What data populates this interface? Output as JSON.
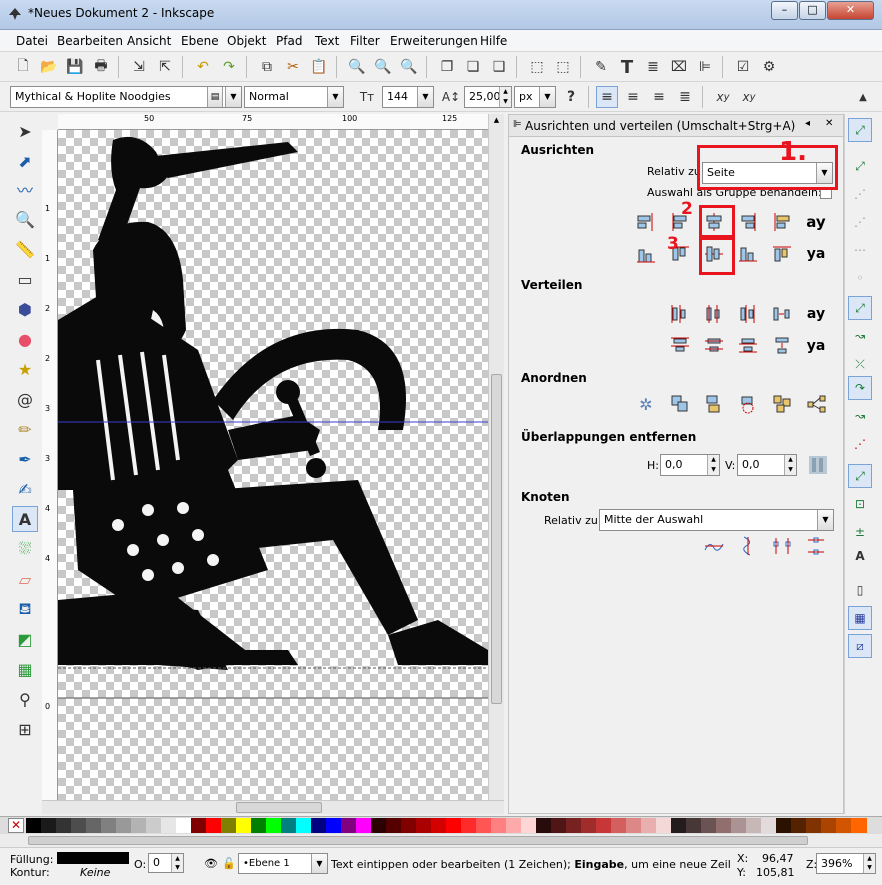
{
  "window": {
    "title": "*Neues Dokument 2 - Inkscape",
    "minimize": "–",
    "maximize": "□",
    "close": "✕"
  },
  "menu": [
    "Datei",
    "Bearbeiten",
    "Ansicht",
    "Ebene",
    "Objekt",
    "Pfad",
    "Text",
    "Filter",
    "Erweiterungen",
    "Hilfe"
  ],
  "text_toolbar": {
    "font_family": "Mythical & Hoplite Noodgies",
    "font_style": "Normal",
    "font_size": "144",
    "line_spacing": "25,00",
    "unit": "px",
    "help": "?"
  },
  "rulers": {
    "top": [
      "50",
      "75",
      "100",
      "125"
    ],
    "left": [
      "1",
      "1",
      "2",
      "2",
      "3",
      "3",
      "4",
      "4",
      "0"
    ]
  },
  "panel": {
    "title": "Ausrichten und verteilen (Umschalt+Strg+A)",
    "align": {
      "heading": "Ausrichten",
      "relative_label": "Relativ zu:",
      "relative_value": "Seite",
      "group_label": "Auswahl als Gruppe behandeln:"
    },
    "distribute": {
      "heading": "Verteilen"
    },
    "arrange": {
      "heading": "Anordnen"
    },
    "overlap": {
      "heading": "Überlappungen entfernen",
      "h_label": "H:",
      "h_value": "0,0",
      "v_label": "V:",
      "v_value": "0,0"
    },
    "nodes": {
      "heading": "Knoten",
      "relative_label": "Relativ zu:",
      "relative_value": "Mitte der Auswahl"
    },
    "annotations": [
      "1.",
      "2",
      "3"
    ]
  },
  "status": {
    "fill_label": "Füllung:",
    "stroke_label": "Kontur:",
    "stroke_value": "Keine",
    "opacity_label": "O:",
    "opacity_value": "0",
    "layer": "•Ebene 1",
    "message_pre": "Text eintippen oder bearbeiten (1 Zeichen); ",
    "message_bold": "Eingabe",
    "message_post": ", um eine neue Zeile zu...",
    "x_label": "X:",
    "x_value": "96,47",
    "y_label": "Y:",
    "y_value": "105,81",
    "zoom_label": "Z:",
    "zoom_value": "396%"
  },
  "colors": {
    "accent": "#e8141e",
    "guide": "#3b3bd4",
    "figure": "#0a0a0a"
  },
  "palette": [
    "#000000",
    "#1a1a1a",
    "#333333",
    "#4d4d4d",
    "#666666",
    "#808080",
    "#999999",
    "#b3b3b3",
    "#cccccc",
    "#e6e6e6",
    "#ffffff",
    "#800000",
    "#ff0000",
    "#808000",
    "#ffff00",
    "#008000",
    "#00ff00",
    "#008080",
    "#00ffff",
    "#000080",
    "#0000ff",
    "#800080",
    "#ff00ff",
    "#2b0000",
    "#550000",
    "#800000",
    "#aa0000",
    "#d40000",
    "#ff0000",
    "#ff2a2a",
    "#ff5555",
    "#ff8080",
    "#ffaaaa",
    "#ffd5d5",
    "#280b0b",
    "#501616",
    "#782121",
    "#a02c2c",
    "#c83737",
    "#d35f5f",
    "#de8787",
    "#e9afaf",
    "#f4d7d7",
    "#241c1c",
    "#483737",
    "#6c5353",
    "#916f6f",
    "#ac9393",
    "#c8b7b7",
    "#e3dbdb",
    "#2b1100",
    "#552200",
    "#803300",
    "#aa4400",
    "#d45500",
    "#ff6600"
  ]
}
